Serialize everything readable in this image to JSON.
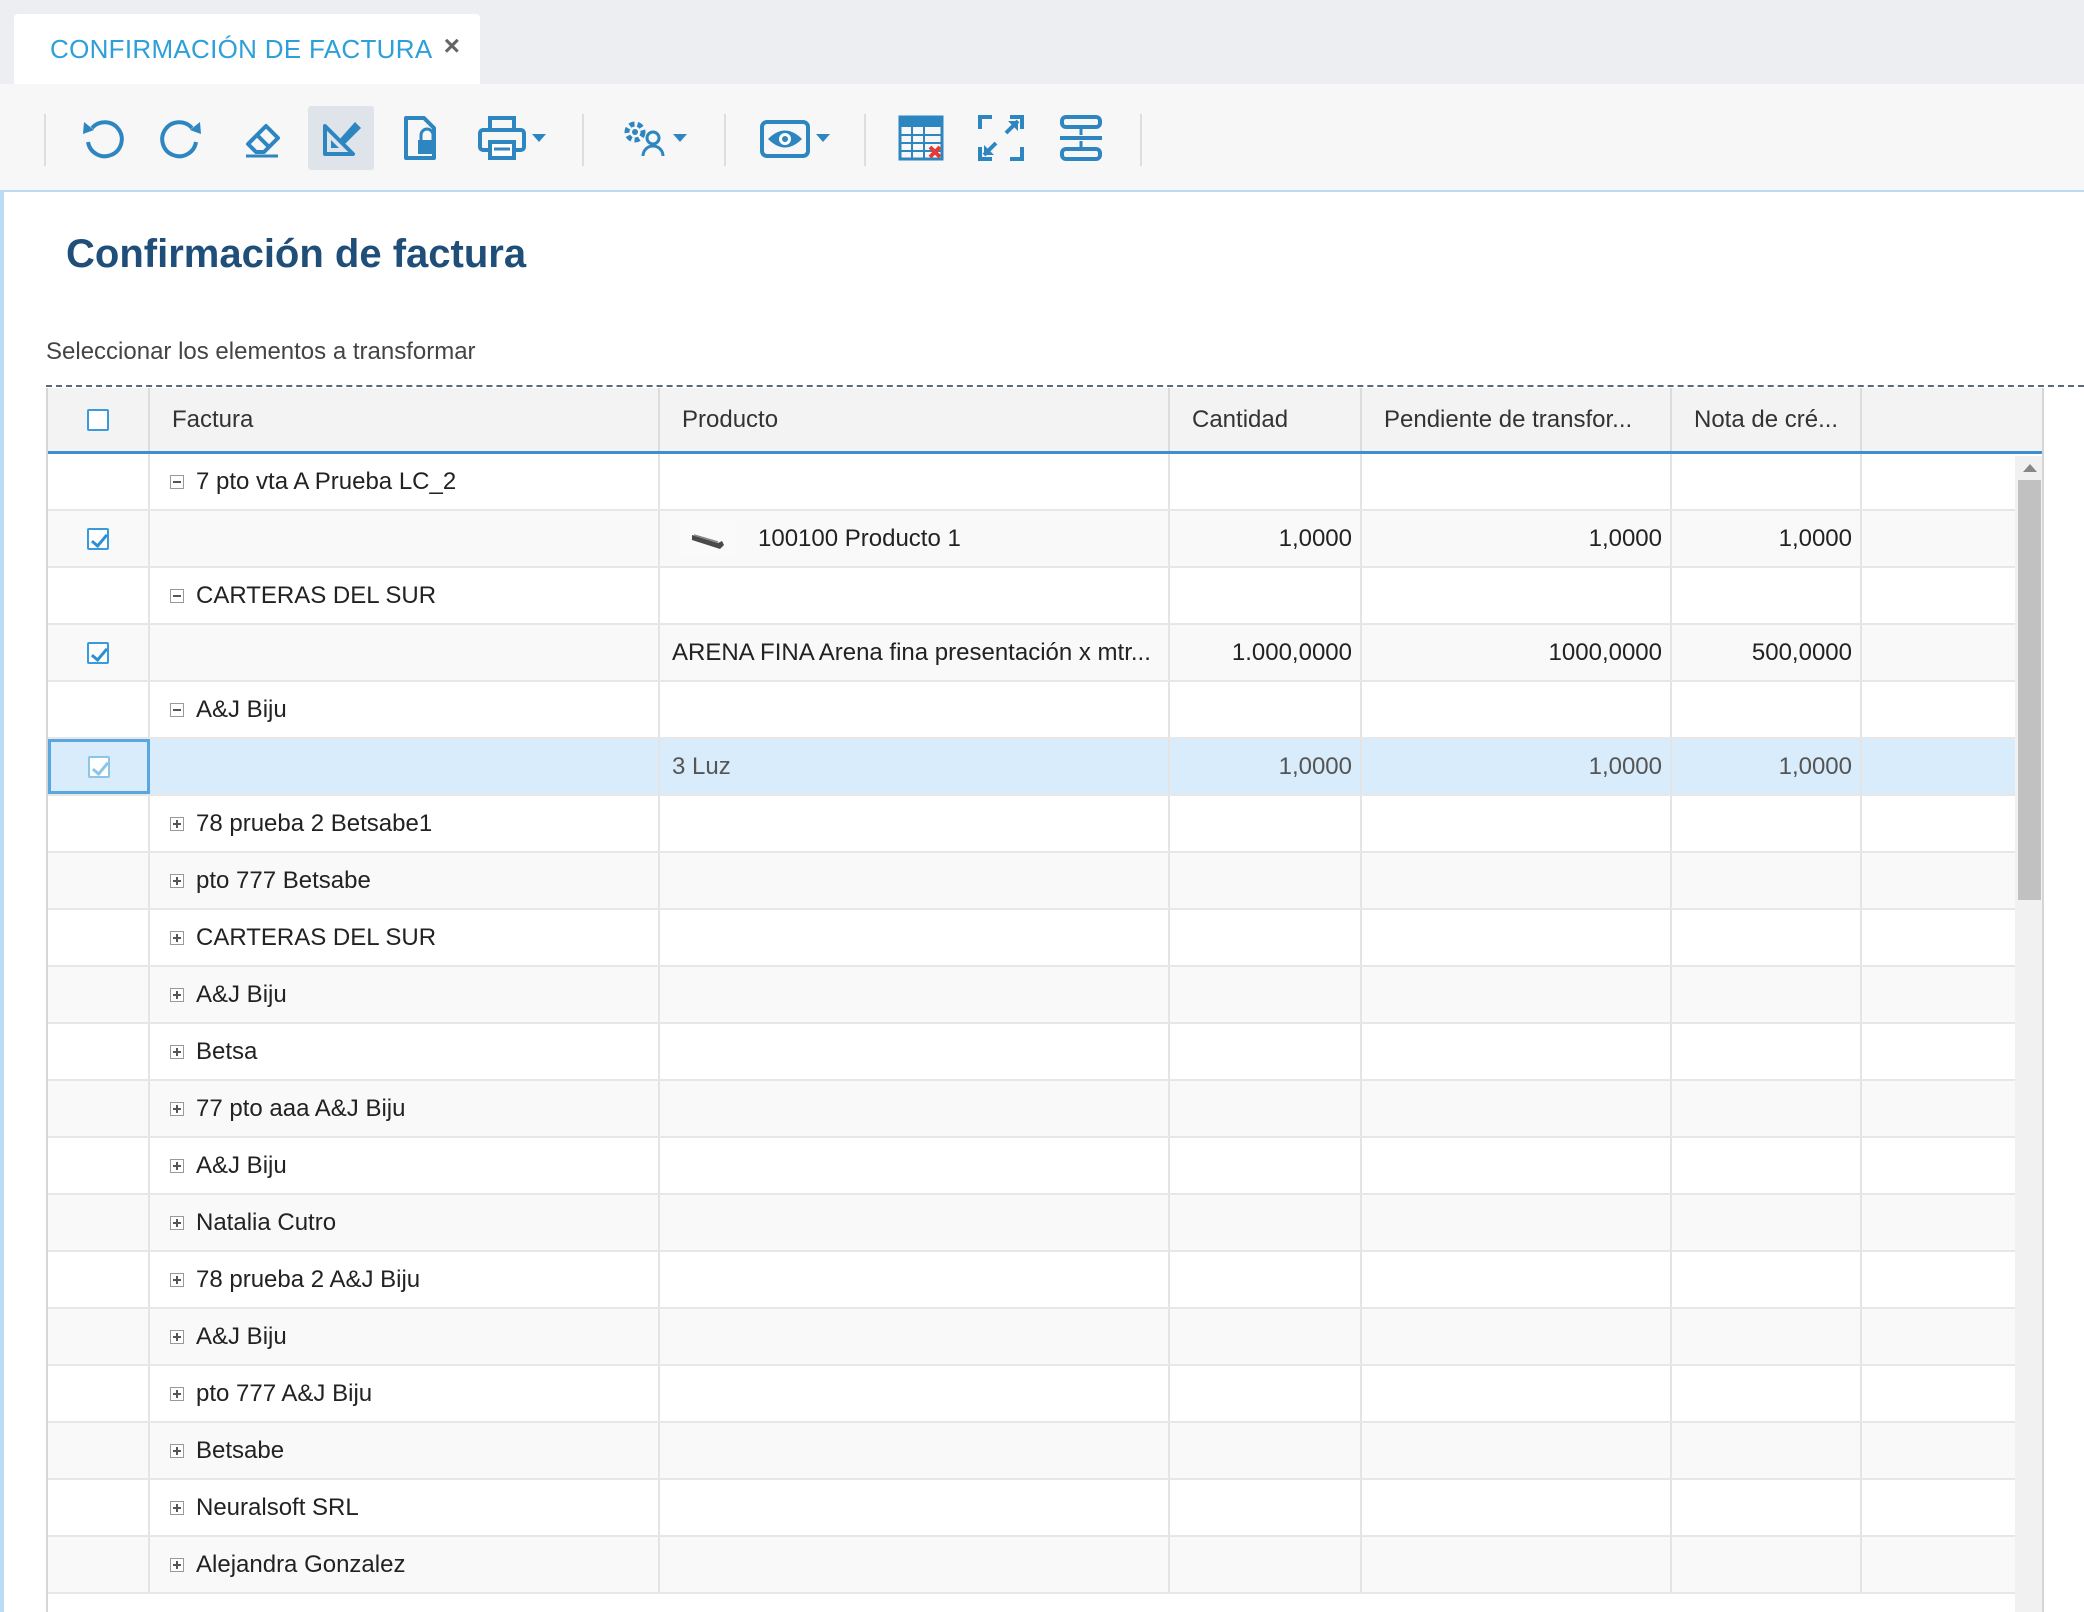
{
  "tab": {
    "label": "CONFIRMACIÓN DE FACTURA",
    "close": "×"
  },
  "toolbar": {
    "icons": [
      "undo-icon",
      "redo-icon",
      "eraser-icon",
      "design-icon",
      "document-lock-icon",
      "print-icon",
      "settings-users-icon",
      "view-icon",
      "grid-clear-icon",
      "expand-icon",
      "split-icon"
    ]
  },
  "page": {
    "title": "Confirmación de factura",
    "subtitle": "Seleccionar los elementos a transformar"
  },
  "grid": {
    "columns": [
      "Factura",
      "Producto",
      "Cantidad",
      "Pendiente de transfor...",
      "Nota de cré..."
    ],
    "rows": [
      {
        "type": "group",
        "label": "7 pto vta A Prueba LC_2",
        "expanded": true
      },
      {
        "type": "item",
        "checked": true,
        "product": "100100 Producto 1",
        "has_image": true,
        "cantidad": "1,0000",
        "pendiente": "1,0000",
        "nota": "1,0000"
      },
      {
        "type": "group",
        "label": "CARTERAS DEL SUR",
        "expanded": true
      },
      {
        "type": "item",
        "checked": true,
        "product": "ARENA FINA Arena fina presentación x mtr...",
        "cantidad": "1.000,0000",
        "pendiente": "1000,0000",
        "nota": "500,0000"
      },
      {
        "type": "group",
        "label": "A&J Biju",
        "expanded": true
      },
      {
        "type": "item",
        "checked": true,
        "selected": true,
        "product": "3 Luz",
        "cantidad": "1,0000",
        "pendiente": "1,0000",
        "nota": "1,0000"
      },
      {
        "type": "group",
        "label": "78 prueba 2 Betsabe1",
        "expanded": false
      },
      {
        "type": "group",
        "label": "pto 777 Betsabe",
        "expanded": false
      },
      {
        "type": "group",
        "label": "CARTERAS DEL SUR",
        "expanded": false
      },
      {
        "type": "group",
        "label": "A&J Biju",
        "expanded": false
      },
      {
        "type": "group",
        "label": "Betsa",
        "expanded": false
      },
      {
        "type": "group",
        "label": "77 pto aaa A&J Biju",
        "expanded": false
      },
      {
        "type": "group",
        "label": "A&J Biju",
        "expanded": false
      },
      {
        "type": "group",
        "label": "Natalia Cutro",
        "expanded": false
      },
      {
        "type": "group",
        "label": "78 prueba 2 A&J Biju",
        "expanded": false
      },
      {
        "type": "group",
        "label": "A&J Biju",
        "expanded": false
      },
      {
        "type": "group",
        "label": "pto 777 A&J Biju",
        "expanded": false
      },
      {
        "type": "group",
        "label": "Betsabe",
        "expanded": false
      },
      {
        "type": "group",
        "label": "Neuralsoft SRL",
        "expanded": false
      },
      {
        "type": "group",
        "label": "Alejandra Gonzalez",
        "expanded": false
      }
    ]
  },
  "colors": {
    "accent": "#2d9fd9",
    "title": "#1f4e79",
    "selected_row": "#d8ecfb",
    "icon_blue": "#2e86c1"
  }
}
